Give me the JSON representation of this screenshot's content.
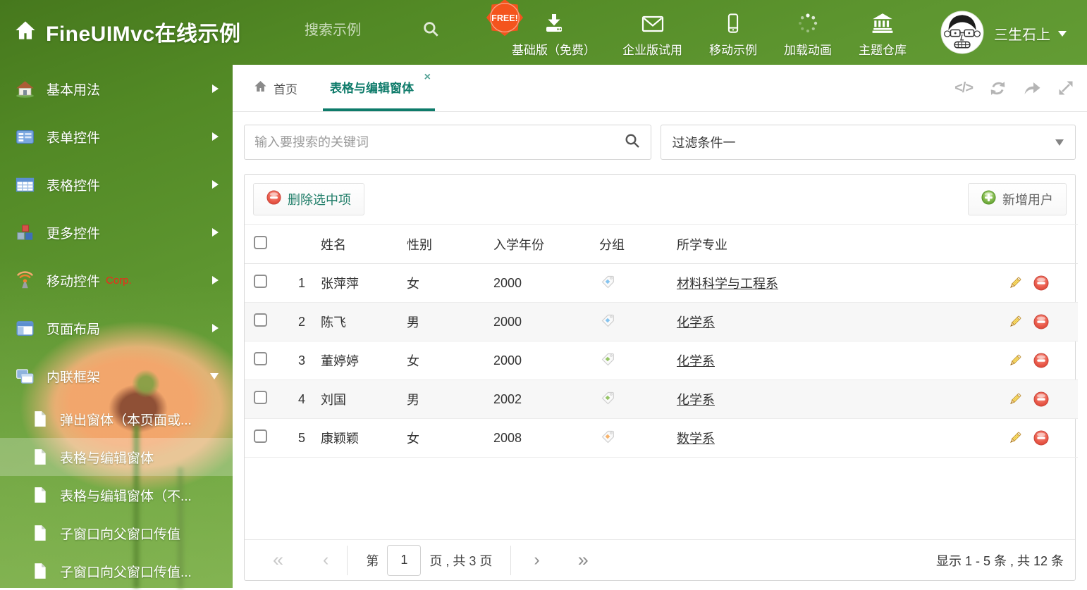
{
  "header": {
    "logo_title": "FineUIMvc在线示例",
    "search_placeholder": "搜索示例",
    "free_badge": "FREE!",
    "nav": [
      {
        "label": "基础版（免费）",
        "icon": "download-icon"
      },
      {
        "label": "企业版试用",
        "icon": "envelope-icon"
      },
      {
        "label": "移动示例",
        "icon": "mobile-icon"
      },
      {
        "label": "加载动画",
        "icon": "spinner-icon"
      },
      {
        "label": "主题仓库",
        "icon": "bank-icon"
      }
    ],
    "user_name": "三生石上"
  },
  "sidebar": {
    "items": [
      {
        "label": "基本用法",
        "icon": "home-icon"
      },
      {
        "label": "表单控件",
        "icon": "form-icon"
      },
      {
        "label": "表格控件",
        "icon": "table-icon"
      },
      {
        "label": "更多控件",
        "icon": "cubes-icon"
      },
      {
        "label": "移动控件",
        "badge": "Corp.",
        "icon": "antenna-icon"
      },
      {
        "label": "页面布局",
        "icon": "layout-icon"
      },
      {
        "label": "内联框架",
        "icon": "frames-icon"
      }
    ],
    "subitems": [
      {
        "label": "弹出窗体（本页面或..."
      },
      {
        "label": "表格与编辑窗体"
      },
      {
        "label": "表格与编辑窗体（不..."
      },
      {
        "label": "子窗口向父窗口传值"
      },
      {
        "label": "子窗口向父窗口传值..."
      }
    ]
  },
  "tabs": {
    "home_label": "首页",
    "active_label": "表格与编辑窗体",
    "close_glyph": "×"
  },
  "filters": {
    "search_placeholder": "输入要搜索的关键词",
    "selected_filter": "过滤条件一"
  },
  "toolbar": {
    "delete_label": "删除选中项",
    "add_label": "新增用户"
  },
  "table": {
    "headers": [
      "姓名",
      "性别",
      "入学年份",
      "分组",
      "所学专业"
    ],
    "rows": [
      {
        "num": "1",
        "name": "张萍萍",
        "gender": "女",
        "year": "2000",
        "tag_color": "#85c3ee",
        "major": "材料科学与工程系"
      },
      {
        "num": "2",
        "name": "陈飞",
        "gender": "男",
        "year": "2000",
        "tag_color": "#85c3ee",
        "major": "化学系"
      },
      {
        "num": "3",
        "name": "董婷婷",
        "gender": "女",
        "year": "2000",
        "tag_color": "#95c465",
        "major": "化学系"
      },
      {
        "num": "4",
        "name": "刘国",
        "gender": "男",
        "year": "2002",
        "tag_color": "#95c465",
        "major": "化学系"
      },
      {
        "num": "5",
        "name": "康颖颖",
        "gender": "女",
        "year": "2008",
        "tag_color": "#f6b26a",
        "major": "数学系"
      }
    ]
  },
  "pagination": {
    "first": "«",
    "prev": "‹",
    "page_prefix": "第",
    "page_value": "1",
    "page_suffix": "页 , 共 3 页",
    "next": "›",
    "last": "»",
    "summary": "显示 1 - 5 条 , 共 12 条"
  },
  "colors": {
    "accent_teal": "#0e7b6a",
    "delete_red": "#e2463a",
    "add_green": "#69a935",
    "corp_red": "#f3261a",
    "free_badge_orange": "#f4541d"
  }
}
